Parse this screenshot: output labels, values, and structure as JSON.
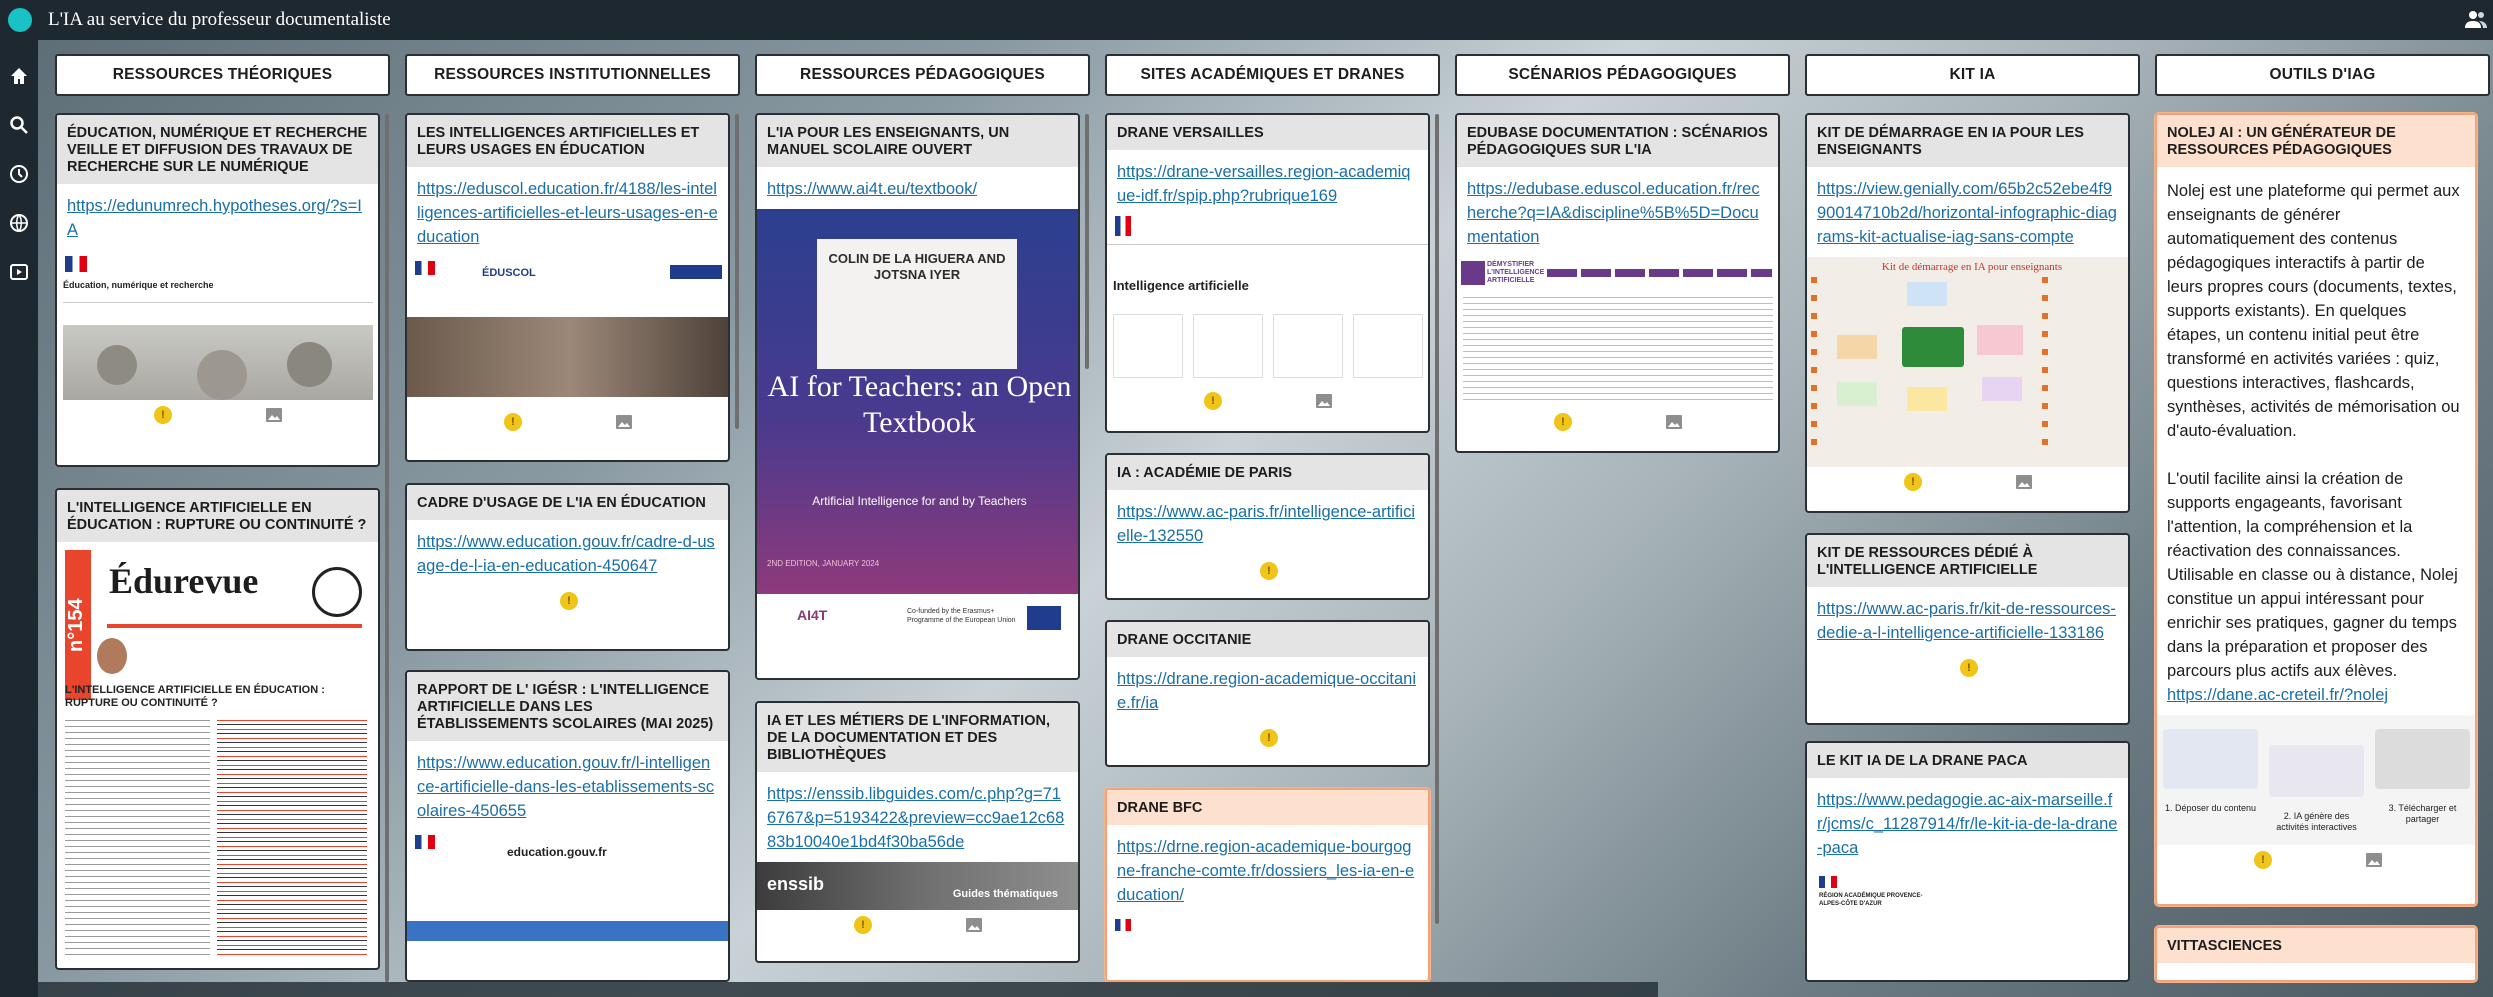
{
  "app": {
    "title": "L'IA au service du professeur documentaliste"
  },
  "columns": [
    {
      "title": "RESSOURCES THÉORIQUES"
    },
    {
      "title": "RESSOURCES INSTITUTIONNELLES"
    },
    {
      "title": "RESSOURCES PÉDAGOGIQUES"
    },
    {
      "title": "SITES ACADÉMIQUES ET DRANES"
    },
    {
      "title": "SCÉNARIOS PÉDAGOGIQUES"
    },
    {
      "title": "KIT IA"
    },
    {
      "title": "OUTILS D'IAG"
    }
  ],
  "cards": {
    "c1a": {
      "title": "ÉDUCATION, NUMÉRIQUE ET RECHERCHE VEILLE ET DIFFUSION DES TRAVAUX DE RECHERCHE SUR LE NUMÉRIQUE",
      "link": "https://edunumrech.hypotheses.org/?s=IA",
      "preview_title": "Éducation, numérique et recherche"
    },
    "c1b": {
      "title": "L'INTELLIGENCE ARTIFICIELLE EN ÉDUCATION : RUPTURE OU CONTINUITÉ ?",
      "brand": "Édurevue",
      "issue": "n°154",
      "headline": "L'INTELLIGENCE ARTIFICIELLE EN ÉDUCATION : RUPTURE OU CONTINUITÉ ?"
    },
    "c2a": {
      "title": "LES INTELLIGENCES ARTIFICIELLES ET LEURS USAGES EN ÉDUCATION",
      "link": "https://eduscol.education.fr/4188/les-intelligences-artificielles-et-leurs-usages-en-education",
      "preview_brand": "ÉDUSCOL"
    },
    "c2b": {
      "title": "CADRE D'USAGE DE L'IA EN ÉDUCATION",
      "link": "https://www.education.gouv.fr/cadre-d-usage-de-l-ia-en-education-450647"
    },
    "c2c": {
      "title": "RAPPORT DE L' IGÉSR : L'INTELLIGENCE ARTIFICIELLE DANS LES ÉTABLISSEMENTS SCOLAIRES (MAI 2025)",
      "link": "https://www.education.gouv.fr/l-intelligence-artificielle-dans-les-etablissements-scolaires-450655",
      "preview_brand": "education.gouv.fr"
    },
    "c3a": {
      "title": "L'IA POUR LES ENSEIGNANTS, UN MANUEL SCOLAIRE OUVERT",
      "link": "https://www.ai4t.eu/textbook/",
      "book_authors": "COLIN DE LA HIGUERA AND JOTSNA IYER",
      "book_title": "AI for Teachers: an Open Textbook",
      "book_subtitle": "Artificial Intelligence for and by Teachers",
      "book_edition": "2ND EDITION, JANUARY 2024",
      "book_logo": "AI4T",
      "book_funding": "Co-funded by the Erasmus+ Programme of the European Union"
    },
    "c3b": {
      "title": "IA ET LES MÉTIERS DE L'INFORMATION, DE LA DOCUMENTATION ET DES BIBLIOTHÈQUES",
      "link": "https://enssib.libguides.com/c.php?g=716767&p=5193422&preview=cc9ae12c6883b10040e1bd4f30ba56de",
      "preview_brand": "enssib",
      "preview_caption": "Guides thématiques"
    },
    "c4a": {
      "title": "DRANE VERSAILLES",
      "link": "https://drane-versailles.region-academique-idf.fr/spip.php?rubrique169",
      "preview_heading": "Intelligence artificielle"
    },
    "c4b": {
      "title": "IA : ACADÉMIE DE PARIS",
      "link": "https://www.ac-paris.fr/intelligence-artificielle-132550"
    },
    "c4c": {
      "title": "DRANE OCCITANIE",
      "link": "https://drane.region-academique-occitanie.fr/ia"
    },
    "c4d": {
      "title": "DRANE BFC",
      "link": "https://drne.region-academique-bourgogne-franche-comte.fr/dossiers_les-ia-en-education/"
    },
    "c5a": {
      "title": "EDUBASE DOCUMENTATION : SCÉNARIOS PÉDAGOGIQUES SUR L'IA",
      "link": "https://edubase.eduscol.education.fr/recherche?q=IA&discipline%5B%5D=Documentation",
      "preview_heading": "DÉMYSTIFIER L'INTELLIGENCE ARTIFICIELLE"
    },
    "c6a": {
      "title": "KIT DE DÉMARRAGE EN IA POUR LES ENSEIGNANTS",
      "link": "https://view.genially.com/65b2c52ebe4f990014710b2d/horizontal-infographic-diagrams-kit-actualise-iag-sans-compte",
      "preview_heading": "Kit de démarrage en IA pour enseignants"
    },
    "c6b": {
      "title": "KIT DE RESSOURCES DÉDIÉ À L'INTELLIGENCE ARTIFICIELLE",
      "link": "https://www.ac-paris.fr/kit-de-ressources-dedie-a-l-intelligence-artificielle-133186"
    },
    "c6c": {
      "title": "LE KIT IA DE LA DRANE PACA",
      "link": "https://www.pedagogie.ac-aix-marseille.fr/jcms/c_11287914/fr/le-kit-ia-de-la-drane-paca",
      "preview_brand": "RÉGION ACADÉMIQUE PROVENCE-ALPES-CÔTE D'AZUR"
    },
    "c7a": {
      "title": "NOLEJ AI : UN GÉNÉRATEUR DE RESSOURCES PÉDAGOGIQUES",
      "para1": "Nolej est une plateforme qui permet aux enseignants de générer automatiquement des contenus pédagogiques interactifs à partir de leurs propres cours (documents, textes, supports existants). En quelques étapes, un contenu initial peut être transformé en activités variées : quiz, questions interactives, flashcards, synthèses, activités de mémorisation ou d'auto-évaluation.",
      "para2": "L'outil facilite ainsi la création de supports engageants, favorisant l'attention, la compréhension et la réactivation des connaissances. Utilisable en classe ou à distance, Nolej constitue un appui intéressant pour enrichir ses pratiques, gagner du temps dans la préparation et proposer des parcours plus actifs aux élèves.",
      "link": "https://dane.ac-creteil.fr/?nolej",
      "steps": [
        "1. Déposer du contenu",
        "2. IA génère des activités interactives",
        "3. Télécharger et partager"
      ]
    },
    "c7b": {
      "title": "VITTASCIENCES"
    }
  }
}
